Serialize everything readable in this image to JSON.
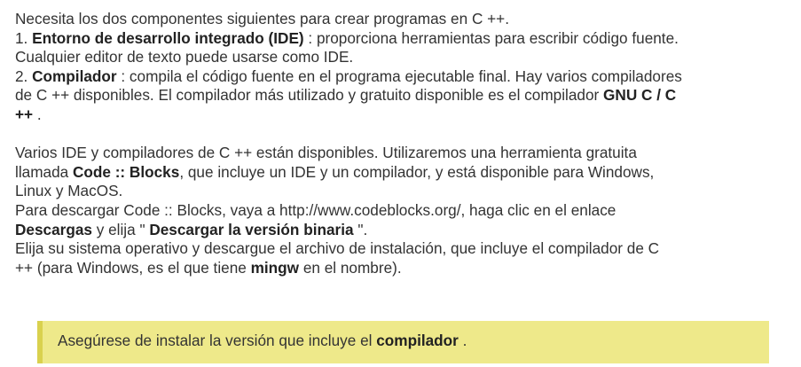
{
  "paragraph1": {
    "line1": "Necesita los dos componentes siguientes para crear programas en C ++.",
    "item1": {
      "number": "1. ",
      "term": "Entorno de desarrollo integrado (IDE)",
      "text": " : proporciona herramientas para escribir código fuente.",
      "line2": "Cualquier editor de texto puede usarse como IDE."
    },
    "item2": {
      "number": "2. ",
      "term": "Compilador",
      "text": " : compila el código fuente en el programa ejecutable final. Hay varios compiladores",
      "line2": "de C ++ disponibles. El compilador más utilizado y gratuito disponible es el compilador ",
      "term2": "GNU C / C",
      "term2_cont": "++",
      "end": " ."
    }
  },
  "paragraph2": {
    "line1": "Varios IDE y compiladores de C ++ están disponibles. Utilizaremos una herramienta gratuita",
    "line2_pre": "llamada ",
    "line2_term": "Code :: Blocks",
    "line2_post": ", que incluye un IDE y un compilador, y está disponible para Windows,",
    "line3": "Linux y MacOS.",
    "line4": "Para descargar Code :: Blocks, vaya a http://www.codeblocks.org/, haga clic en el enlace",
    "line5_term": "Descargas",
    "line5_mid": " y elija \" ",
    "line5_term2": "Descargar la versión binaria",
    "line5_end": " \".",
    "line6": "Elija su sistema operativo y descargue el archivo de instalación, que incluye el compilador de C",
    "line7_pre": "++ (para Windows, es el que tiene ",
    "line7_term": "mingw",
    "line7_post": " en el nombre)."
  },
  "note": {
    "text": "Asegúrese de instalar la versión que incluye el ",
    "term": "compilador",
    "end": " ."
  },
  "colors": {
    "note_background": "#eee98a",
    "note_border": "#d9d14e",
    "text": "#333333"
  }
}
